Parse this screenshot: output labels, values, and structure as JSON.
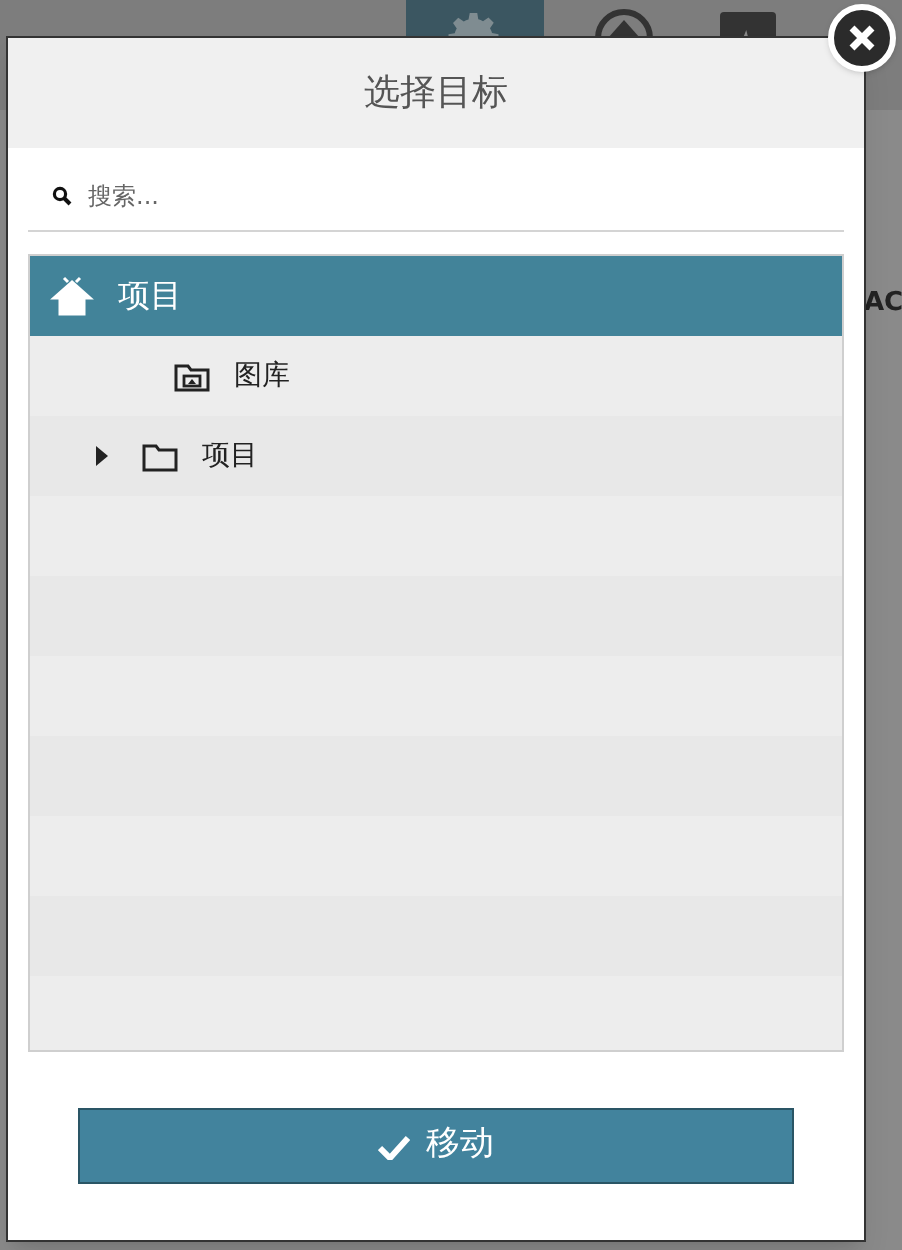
{
  "background": {
    "side_text": "AC"
  },
  "dialog": {
    "title": "选择目标",
    "search": {
      "placeholder": "搜索..."
    },
    "tree": [
      {
        "label": "项目",
        "kind": "home",
        "selected": true,
        "children": [
          {
            "label": "图库",
            "kind": "gallery",
            "selected": false
          },
          {
            "label": "项目",
            "kind": "folder",
            "selected": false,
            "expanded": false
          }
        ]
      }
    ],
    "button": {
      "label": "移动"
    }
  }
}
